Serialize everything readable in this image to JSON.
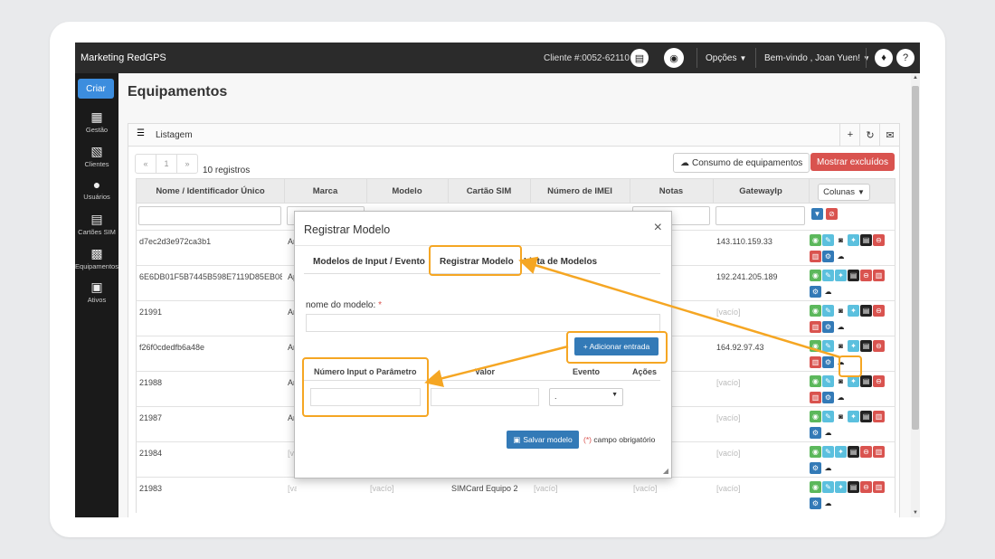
{
  "app": {
    "brand": "Marketing RedGPS",
    "client": "Cliente #:0052-62110",
    "opcoes": "Opções",
    "bemvindo": "Bem-vindo , Joan Yuen!"
  },
  "sidebar": {
    "criar": "Criar",
    "items": [
      {
        "label": "Gestão",
        "icon": "building-icon"
      },
      {
        "label": "Clientes",
        "icon": "clients-icon"
      },
      {
        "label": "Usuários",
        "icon": "user-icon"
      },
      {
        "label": "Cartões SIM",
        "icon": "sim-card-icon"
      },
      {
        "label": "Equipamentos",
        "icon": "equipment-icon"
      },
      {
        "label": "Ativos",
        "icon": "car-icon"
      }
    ]
  },
  "page": {
    "title": "Equipamentos",
    "panel_label": "Listagem",
    "registros": "10 registros",
    "consumo": "Consumo de equipamentos",
    "mostrar": "Mostrar excluídos",
    "colunas": "Colunas",
    "pager": [
      "«",
      "1",
      "»"
    ]
  },
  "table": {
    "headers": [
      "Nome / Identificador Único",
      "Marca",
      "Modelo",
      "Cartão SIM",
      "Número de IMEI",
      "Notas",
      "GatewayIp"
    ],
    "rows": [
      {
        "nome": "d7ec2d3e972ca3b1",
        "marca": "Ar",
        "gw": "143.110.159.33",
        "gw_vacio": false
      },
      {
        "nome": "6E6DB01F5B7445B598E7119D85EB088E",
        "marca": "Ap",
        "gw": "192.241.205.189",
        "gw_vacio": false
      },
      {
        "nome": "21991",
        "marca": "Ar",
        "gw": "[vacío]",
        "gw_vacio": true
      },
      {
        "nome": "f26f0cdedfb6a48e",
        "marca": "Ar",
        "gw": "164.92.97.43",
        "gw_vacio": false
      },
      {
        "nome": "21988",
        "marca": "Ar",
        "gw": "[vacío]",
        "gw_vacio": true
      },
      {
        "nome": "21987",
        "marca": "Ar",
        "gw": "[vacío]",
        "gw_vacio": true
      },
      {
        "nome": "21984",
        "marca": "[vacío]",
        "gw": "[vacío]",
        "gw_vacio": true
      },
      {
        "nome": "21983",
        "marca": "[vacío]",
        "modelo": "[vacío]",
        "sim": "SIMCard Equipo 2",
        "imei": "[vacío]",
        "notas": "[vacío]",
        "gw": "[vacío]",
        "gw_vacio": true
      }
    ]
  },
  "modal": {
    "title": "Registrar Modelo",
    "close": "×",
    "tabs": [
      "Modelos de Input / Evento",
      "Registrar Modelo",
      "Lista de Modelos"
    ],
    "nome_label": "nome do modelo:",
    "req": "*",
    "add": "+ Adicionar entrada",
    "cols": [
      "Número Input o Parâmetro",
      "Valor",
      "Evento",
      "Ações"
    ],
    "select_value": ".",
    "salvar": "Salvar modelo",
    "campo_req_mark": "(*)",
    "campo": "campo obrigatório"
  },
  "colors": {
    "highlight": "#f5a623",
    "primary": "#337ab7",
    "danger": "#d9534f"
  }
}
